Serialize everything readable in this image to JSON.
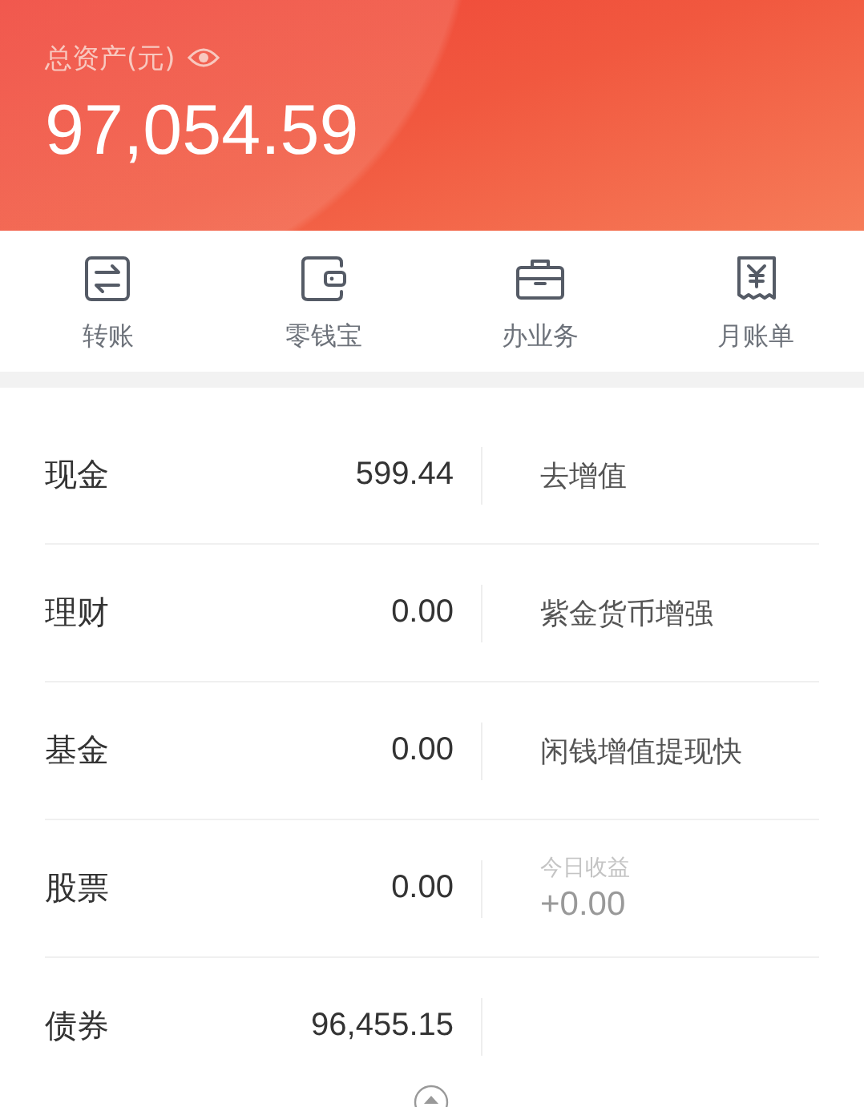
{
  "header": {
    "title": "总资产(元)",
    "total": "97,054.59"
  },
  "shortcuts": [
    {
      "kind": "transfer",
      "label": "转账"
    },
    {
      "kind": "wallet",
      "label": "零钱宝"
    },
    {
      "kind": "briefcase",
      "label": "办业务"
    },
    {
      "kind": "bill",
      "label": "月账单"
    }
  ],
  "assets": [
    {
      "name": "现金",
      "amount": "599.44",
      "side": {
        "kind": "link",
        "text": "去增值"
      }
    },
    {
      "name": "理财",
      "amount": "0.00",
      "side": {
        "kind": "link",
        "text": "紫金货币增强"
      }
    },
    {
      "name": "基金",
      "amount": "0.00",
      "side": {
        "kind": "link",
        "text": "闲钱增值提现快"
      }
    },
    {
      "name": "股票",
      "amount": "0.00",
      "side": {
        "kind": "earning",
        "label": "今日收益",
        "value": "+0.00"
      }
    },
    {
      "name": "债券",
      "amount": "96,455.15",
      "side": {
        "kind": "none"
      }
    }
  ]
}
